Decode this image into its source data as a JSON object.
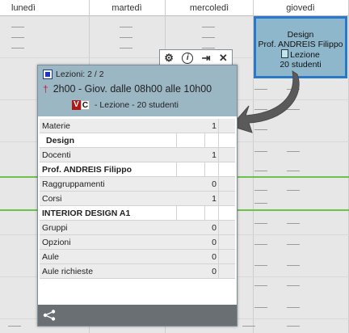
{
  "calendar": {
    "days": [
      "lunedì",
      "martedì",
      "mercoledì",
      "giovedì"
    ]
  },
  "event": {
    "line1": "Design",
    "line2": "Prof. ANDREIS Filippo",
    "line3": "Lezione",
    "line4": "20 studenti"
  },
  "popup": {
    "header": {
      "lessons": "Lezioni: 2 / 2",
      "time": "2h00 - Giov. dalle 08h00 alle 10h00",
      "badge_v": "V",
      "badge_c": "C",
      "lesson_info": "- Lezione - 20 studenti"
    },
    "rows": {
      "materie": {
        "label": "Materie",
        "value": "1"
      },
      "materia_item": "Design",
      "docenti": {
        "label": "Docenti",
        "value": "1"
      },
      "docente_item": "Prof. ANDREIS Filippo",
      "raggruppamenti": {
        "label": "Raggruppamenti",
        "value": "0"
      },
      "corsi": {
        "label": "Corsi",
        "value": "1"
      },
      "corso_item": "INTERIOR DESIGN A1",
      "gruppi": {
        "label": "Gruppi",
        "value": "0"
      },
      "opzioni": {
        "label": "Opzioni",
        "value": "0"
      },
      "aule": {
        "label": "Aule",
        "value": "0"
      },
      "aule_richieste": {
        "label": "Aule richieste",
        "value": "0"
      }
    }
  }
}
